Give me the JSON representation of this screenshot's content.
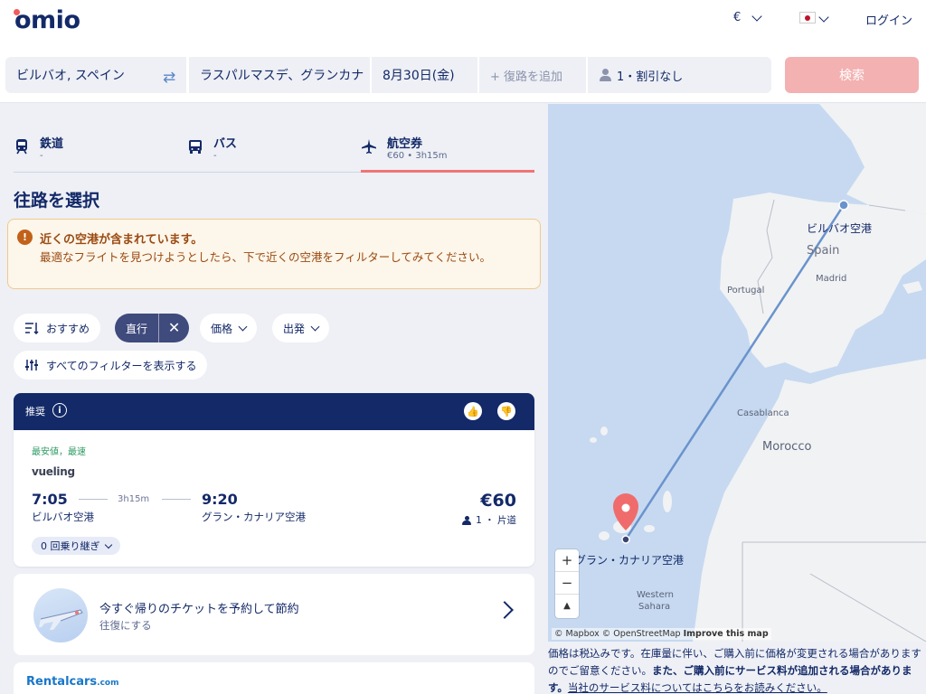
{
  "header": {
    "logo": "omio",
    "currency": "€",
    "login": "ログイン"
  },
  "search": {
    "from": "ビルバオ, スペイン",
    "to": "ラスパルマスデ、グランカナ",
    "date": "8月30日(金)",
    "return_placeholder": "+ 復路を追加",
    "passengers": "1・割引なし",
    "search_button": "検索"
  },
  "tabs": [
    {
      "label": "鉄道",
      "sub": "-"
    },
    {
      "label": "バス",
      "sub": "-"
    },
    {
      "label": "航空券",
      "sub": "€60 • 3h15m"
    }
  ],
  "page_heading": "往路を選択",
  "alert": {
    "title": "近くの空港が含まれています。",
    "body": "最適なフライトを見つけようとしたら、下で近くの空港をフィルターしてみてください。"
  },
  "filters": {
    "sort": "おすすめ",
    "direct": "直行",
    "price": "価格",
    "departure": "出発",
    "all_filters": "すべてのフィルターを表示する"
  },
  "result": {
    "header_label": "推奨",
    "tags": "最安値，最速",
    "airline": "vueling",
    "depart_time": "7:05",
    "depart_airport": "ビルバオ空港",
    "duration": "3h15m",
    "arrive_time": "9:20",
    "arrive_airport": "グラン・カナリア空港",
    "price": "€60",
    "passenger_info": "1 ・ 片道",
    "stops": "0 回乗り継ぎ"
  },
  "return_promo": {
    "title": "今すぐ帰りのチケットを予約して節約",
    "subtitle": "往復にする"
  },
  "rental": {
    "logo": "Rentalcars",
    "logo_suffix": ".com"
  },
  "map": {
    "labels": {
      "bilbao": "ビルバオ空港",
      "spain": "Spain",
      "madrid": "Madrid",
      "portugal": "Portugal",
      "casablanca": "Casablanca",
      "morocco": "Morocco",
      "gran_canaria": "グラン・カナリア空港",
      "western_sahara_1": "Western",
      "western_sahara_2": "Sahara"
    },
    "attribution_1": "© Mapbox © OpenStreetMap",
    "attribution_2": "Improve this map"
  },
  "notes": {
    "text_1": "価格は税込みです。在庫量に伴い、ご購入前に価格が変更される場合がありますのでご留意ください。",
    "text_2": "また、ご購入前にサービス料が追加される場合があります。",
    "link": "当社のサービス料についてはこちらをお読みください。"
  }
}
